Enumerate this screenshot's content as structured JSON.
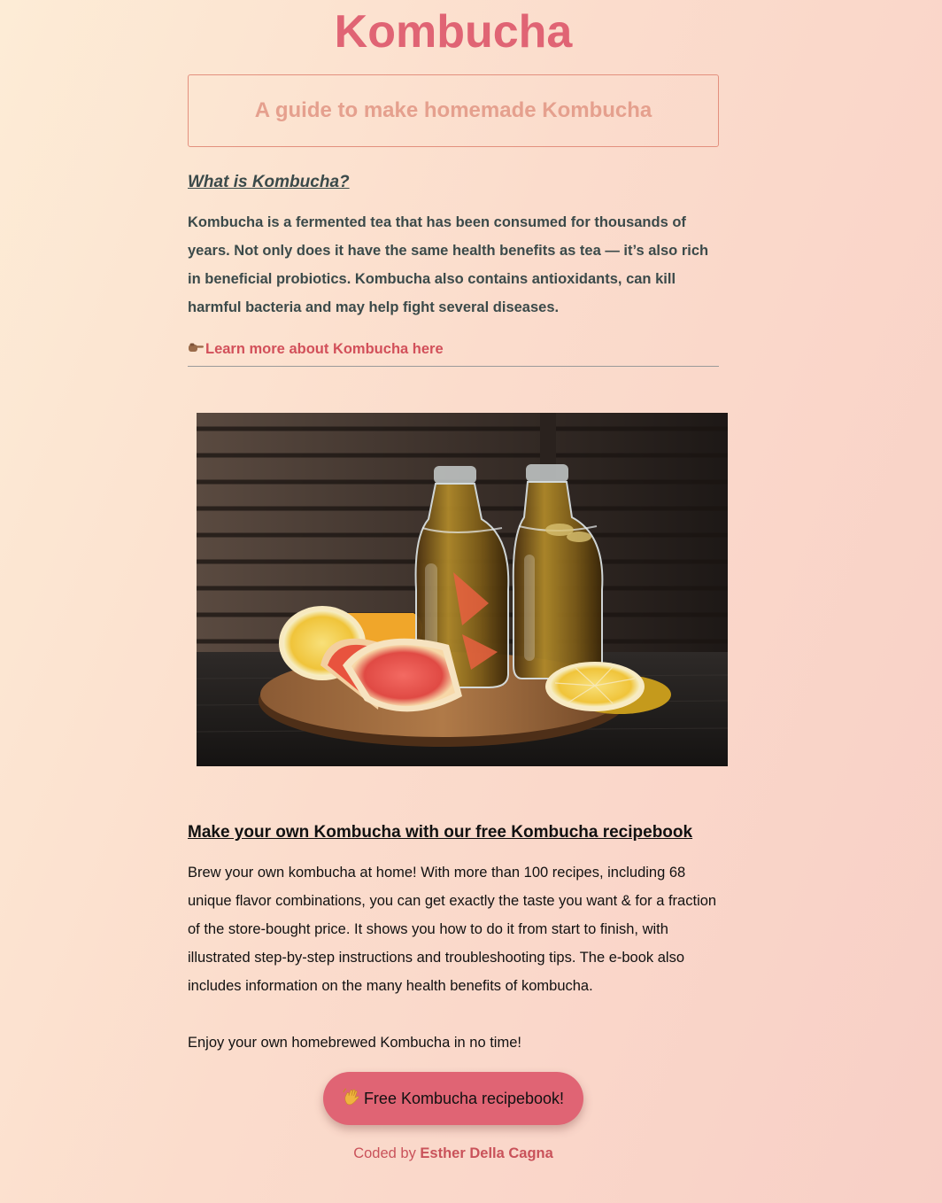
{
  "header": {
    "title": "Kombucha",
    "subtitle": "A guide to make homemade Kombucha"
  },
  "about": {
    "heading": "What is Kombucha?",
    "text": "Kombucha is a fermented tea that has been consumed for thousands of years. Not only does it have the same health benefits as tea — it’s also rich in beneficial probiotics. Kombucha also contains antioxidants, can kill harmful bacteria and may help fight several diseases.",
    "link_icon": "pointing-hand-icon",
    "link_label": "Learn more about Kombucha here"
  },
  "image": {
    "icon": "kombucha-bottles-with-citrus-photo"
  },
  "recipe": {
    "heading": "Make your own Kombucha with our free Kombucha recipebook",
    "text": "Brew your own kombucha at home! With more than 100 recipes, including 68 unique flavor combinations, you can get exactly the taste you want & for a fraction of the store-bought price. It shows you how to do it from start to finish, with illustrated step-by-step instructions and troubleshooting tips. The e-book also includes information on the many health benefits of kombucha.",
    "enjoy": "Enjoy your own homebrewed Kombucha in no time!",
    "button_icon": "waving-hand-icon",
    "button_label": "Free Kombucha recipebook!"
  },
  "footer": {
    "prefix": "Coded by",
    "author": "Esther Della Cagna"
  },
  "colors": {
    "title": "#e06474",
    "subtitle": "#e5a08e",
    "body_text": "#3b4a4a",
    "link": "#d2505a",
    "button_bg": "#e06474",
    "footer": "#c9525a"
  }
}
